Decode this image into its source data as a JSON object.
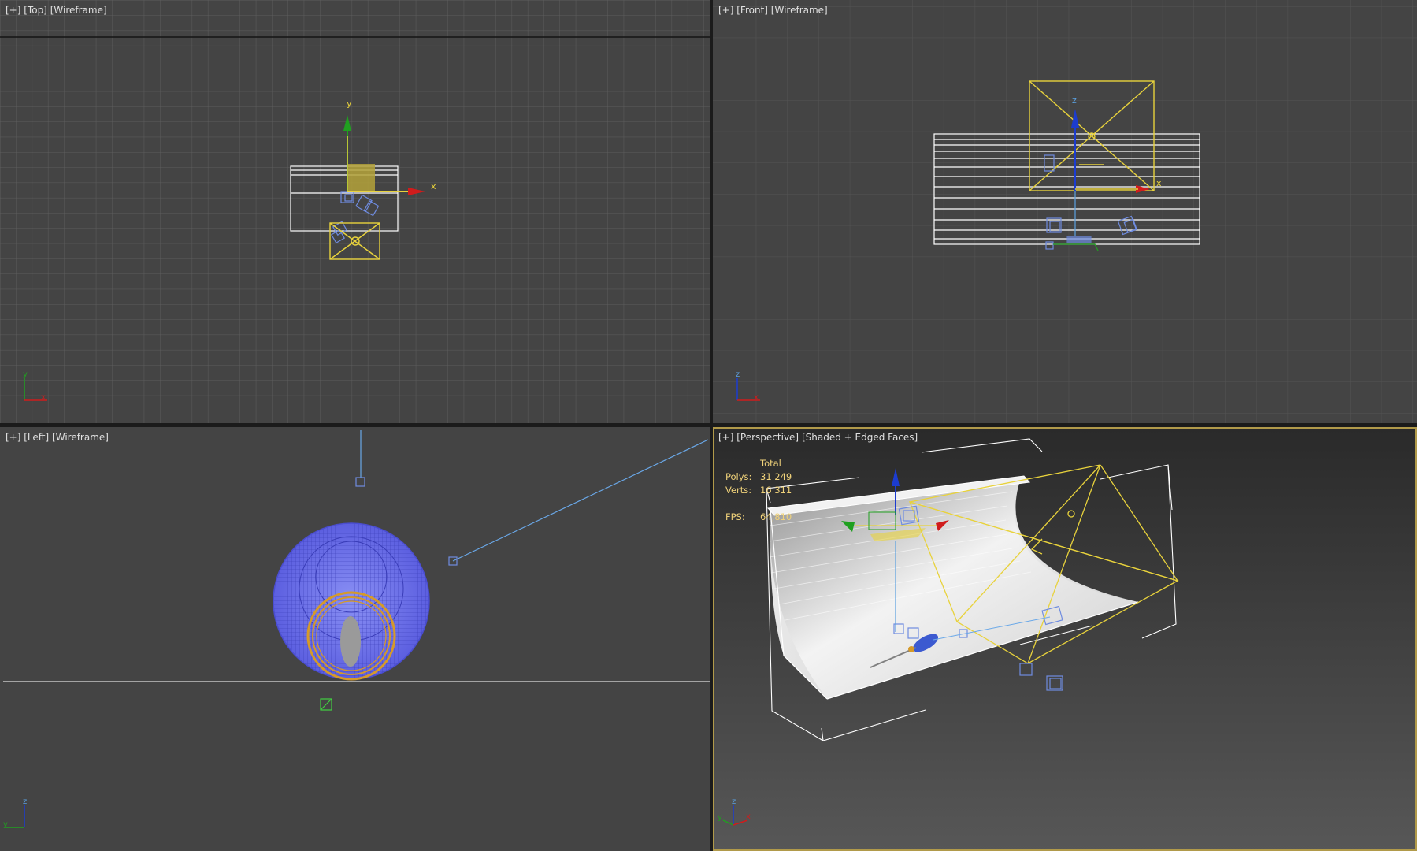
{
  "viewports": {
    "top": {
      "plus": "[+]",
      "view": "[Top]",
      "mode": "[Wireframe]"
    },
    "front": {
      "plus": "[+]",
      "view": "[Front]",
      "mode": "[Wireframe]"
    },
    "left": {
      "plus": "[+]",
      "view": "[Left]",
      "mode": "[Wireframe]"
    },
    "perspective": {
      "plus": "[+]",
      "view": "[Perspective]",
      "mode": "[Shaded + Edged Faces]"
    }
  },
  "stats": {
    "header": "Total",
    "polys_label": "Polys:",
    "polys_value": "31 249",
    "verts_label": "Verts:",
    "verts_value": "16 311",
    "fps_label": "FPS:",
    "fps_value": "64,810"
  },
  "axis_labels": {
    "x": "x",
    "y": "y",
    "z": "z"
  },
  "colors": {
    "selection": "#e8d23c",
    "camera": "#6f8ce0",
    "gizmo_x": "#d01c1c",
    "gizmo_y": "#20a020",
    "gizmo_z": "#1c3cd0",
    "viewport_bg": "#444444",
    "active_border": "#b19a4a"
  }
}
